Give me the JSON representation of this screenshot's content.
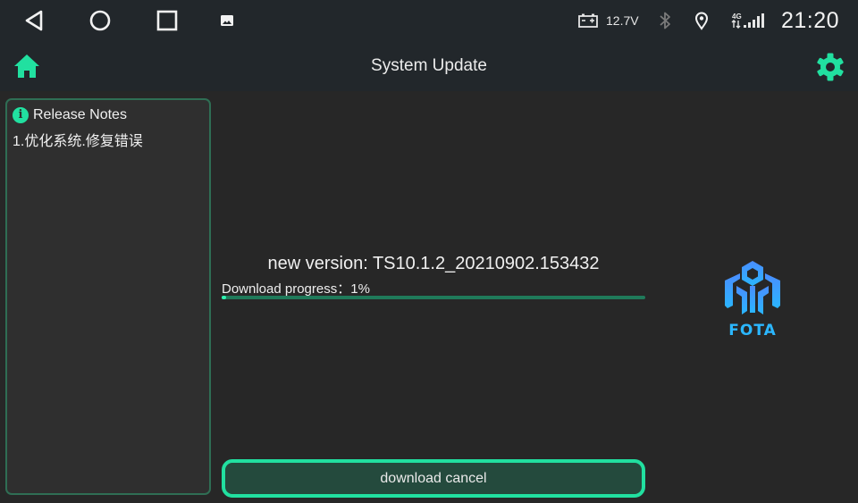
{
  "status_bar": {
    "nav": [
      {
        "name": "back-icon"
      },
      {
        "name": "home-circle-icon"
      },
      {
        "name": "recents-icon"
      },
      {
        "name": "image-notification-icon"
      }
    ],
    "battery_voltage": "12.7V",
    "network_type": "4G",
    "time": "21:20"
  },
  "app_bar": {
    "title": "System Update",
    "home_icon": "home-icon",
    "settings_icon": "gear-icon"
  },
  "release_notes": {
    "title": "Release Notes",
    "items": [
      "1.优化系统.修复错误"
    ]
  },
  "update": {
    "version_text": "new version: TS10.1.2_20210902.153432",
    "progress_label": "Download progress：1%",
    "progress_percent": 1
  },
  "logo": {
    "text": "FOTA"
  },
  "actions": {
    "cancel_label": "download cancel"
  },
  "colors": {
    "accent": "#21e0a0",
    "progress_track": "#1f7a5a",
    "button_fill": "#244a3d",
    "logo_blue": "#3a9dff",
    "logo_text": "#2bb7ff"
  }
}
